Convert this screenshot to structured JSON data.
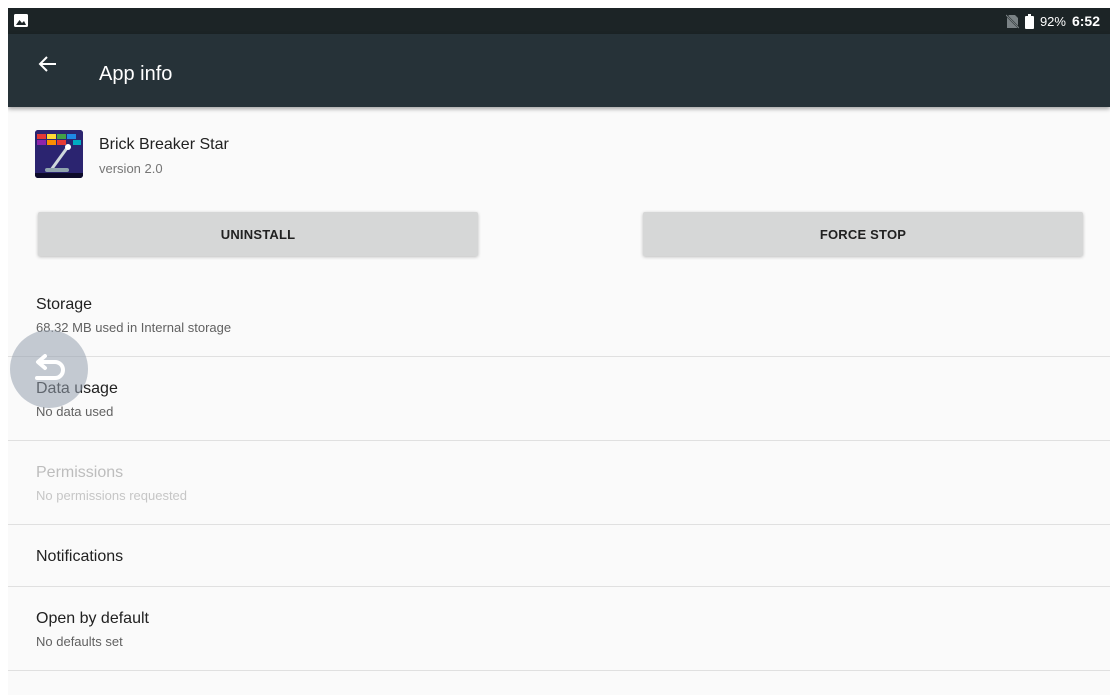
{
  "status_bar": {
    "left_icon": "image-notification-icon",
    "no_sim_icon": "no-sim-icon",
    "battery_icon": "battery-icon",
    "battery": "92%",
    "time": "6:52"
  },
  "app_bar": {
    "back_icon": "arrow-back-icon",
    "title": "App info"
  },
  "app": {
    "name": "Brick Breaker Star",
    "version": "version 2.0"
  },
  "buttons": {
    "uninstall": "UNINSTALL",
    "force_stop": "FORCE STOP"
  },
  "rows": {
    "storage": {
      "title": "Storage",
      "summary": "68.32 MB used in Internal storage"
    },
    "data_usage": {
      "title": "Data usage",
      "summary": "No data used"
    },
    "permissions": {
      "title": "Permissions",
      "summary": "No permissions requested"
    },
    "notifications": {
      "title": "Notifications"
    },
    "open_by_default": {
      "title": "Open by default",
      "summary": "No defaults set"
    }
  },
  "floating": {
    "icon": "undo-back-icon"
  },
  "colors": {
    "app_bar": "#263238",
    "status_bar": "#1c2426",
    "button": "#d6d7d7",
    "background": "#fafafa"
  }
}
